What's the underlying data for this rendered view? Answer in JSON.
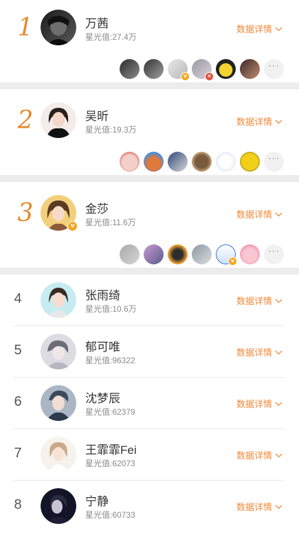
{
  "ranking": [
    {
      "rank": "1",
      "name": "万茜",
      "score": "星光值:27.4万",
      "detail_label": "数据详情",
      "avatar_icon": "avatar-photo-dark",
      "avatar_colors": [
        "#1a1a1a",
        "#5a5a5a"
      ],
      "verified": false,
      "fans": [
        {
          "colors": [
            "#2c2c2c",
            "#8c8c8c"
          ],
          "badge": ""
        },
        {
          "colors": [
            "#333333",
            "#a0a0a0"
          ],
          "badge": ""
        },
        {
          "colors": [
            "#e8e8e8",
            "#b8b8b8"
          ],
          "badge": "v"
        },
        {
          "colors": [
            "#9a9aa6",
            "#d9d0d8"
          ],
          "badge": "x"
        },
        {
          "colors": [
            "#f2d230",
            "#222222"
          ],
          "badge": ""
        },
        {
          "colors": [
            "#3a2a2a",
            "#c48b6e"
          ],
          "badge": ""
        }
      ],
      "more_label": "···"
    },
    {
      "rank": "2",
      "name": "吴昕",
      "score": "星光值:19.3万",
      "detail_label": "数据详情",
      "avatar_icon": "avatar-photo-woman",
      "avatar_colors": [
        "#f1e4df",
        "#222222"
      ],
      "verified": false,
      "fans": [
        {
          "colors": [
            "#f0c9c0",
            "#d76767"
          ],
          "badge": ""
        },
        {
          "colors": [
            "#4a8fd8",
            "#e0793a"
          ],
          "badge": ""
        },
        {
          "colors": [
            "#2f4a78",
            "#d8d8d8"
          ],
          "badge": ""
        },
        {
          "colors": [
            "#7a5a3c",
            "#d4b48c"
          ],
          "badge": ""
        },
        {
          "colors": [
            "#ffffff",
            "#b9c7e6"
          ],
          "badge": ""
        },
        {
          "colors": [
            "#f3d018",
            "#6a6a20"
          ],
          "badge": ""
        }
      ],
      "more_label": "···"
    },
    {
      "rank": "3",
      "name": "金莎",
      "score": "星光值:11.6万",
      "detail_label": "数据详情",
      "avatar_icon": "avatar-photo-woman",
      "avatar_colors": [
        "#f2cf7a",
        "#5a3a22"
      ],
      "verified": true,
      "fans": [
        {
          "colors": [
            "#a8a8a8",
            "#d6d6d6"
          ],
          "badge": ""
        },
        {
          "colors": [
            "#c99bd6",
            "#5a5a8a"
          ],
          "badge": ""
        },
        {
          "colors": [
            "#e59c2e",
            "#2d2d2d"
          ],
          "badge": ""
        },
        {
          "colors": [
            "#8a9aa6",
            "#dcdcdc"
          ],
          "badge": ""
        },
        {
          "colors": [
            "#ffffff",
            "#3a76d6"
          ],
          "badge": "v"
        },
        {
          "colors": [
            "#f9c6d2",
            "#f08aa8"
          ],
          "badge": ""
        }
      ],
      "more_label": "···"
    }
  ],
  "list": [
    {
      "rank": "4",
      "name": "张雨绮",
      "score": "星光值:10.6万",
      "detail_label": "数据详情",
      "avatar_icon": "avatar-photo-woman",
      "avatar_colors": [
        "#bfe9ef",
        "#3a2a22"
      ]
    },
    {
      "rank": "5",
      "name": "郁可唯",
      "score": "星光值:96322",
      "detail_label": "数据详情",
      "avatar_icon": "avatar-photo-woman",
      "avatar_colors": [
        "#d9d9df",
        "#6e6a78"
      ]
    },
    {
      "rank": "6",
      "name": "沈梦辰",
      "score": "星光值:62379",
      "detail_label": "数据详情",
      "avatar_icon": "avatar-photo-woman",
      "avatar_colors": [
        "#aab6c4",
        "#3b4a5c"
      ]
    },
    {
      "rank": "7",
      "name": "王霏霏Fei",
      "score": "星光值:62073",
      "detail_label": "数据详情",
      "avatar_icon": "avatar-photo-woman",
      "avatar_colors": [
        "#f3efe9",
        "#c9a98a"
      ]
    },
    {
      "rank": "8",
      "name": "宁静",
      "score": "星光值:60733",
      "detail_label": "数据详情",
      "avatar_icon": "avatar-photo-woman",
      "avatar_colors": [
        "#141428",
        "#5a5a78"
      ]
    }
  ],
  "colors": {
    "accent": "#f08a3a",
    "rank_accent": "#e58a2e",
    "verified_badge": "#f5a623",
    "divider": "#ececec"
  },
  "icons": {
    "detail_arrow": "chevron-down-icon",
    "more": "more-dots-icon",
    "verified": "verified-v-icon"
  }
}
